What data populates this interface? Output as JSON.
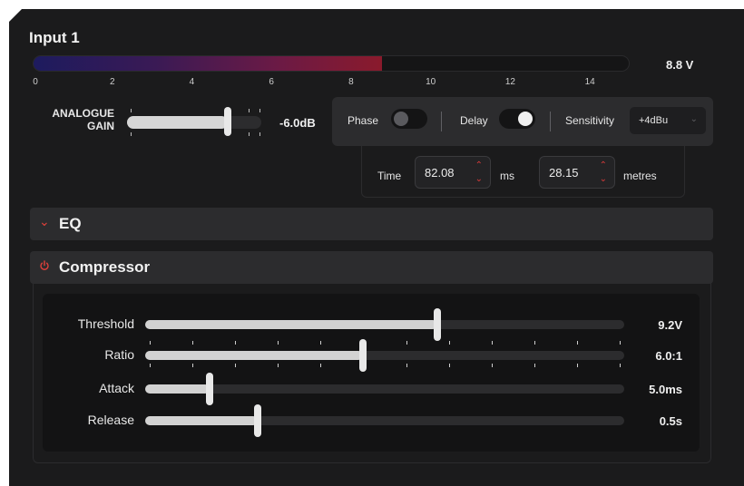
{
  "title": "Input 1",
  "meter": {
    "level_fraction": 0.585,
    "value": "8.8 V",
    "scale": [
      "0",
      "2",
      "4",
      "6",
      "8",
      "10",
      "12",
      "14"
    ]
  },
  "analogue_gain": {
    "label_line1": "ANALOGUE",
    "label_line2": "GAIN",
    "value": "-6.0dB",
    "level_fraction": 0.75
  },
  "options": {
    "phase_label": "Phase",
    "phase_on": false,
    "delay_label": "Delay",
    "delay_on": true,
    "sensitivity_label": "Sensitivity",
    "sensitivity_value": "+4dBu",
    "chevron_icon": "chevron-down-icon"
  },
  "delay_time": {
    "time_label": "Time",
    "time_value": "82.08",
    "time_unit": "ms",
    "distance_value": "28.15",
    "distance_unit": "metres"
  },
  "sections": {
    "eq_title": "EQ",
    "eq_icon": "chevron-down-icon",
    "compressor_title": "Compressor",
    "compressor_icon": "power-icon"
  },
  "compressor": {
    "threshold": {
      "label": "Threshold",
      "value": "9.2V",
      "level_fraction": 0.61
    },
    "ratio": {
      "label": "Ratio",
      "value": "6.0:1",
      "level_fraction": 0.455
    },
    "attack": {
      "label": "Attack",
      "value": "5.0ms",
      "level_fraction": 0.135
    },
    "release": {
      "label": "Release",
      "value": "0.5s",
      "level_fraction": 0.235
    }
  },
  "colors": {
    "accent_red": "#d93a3a",
    "panel_bg": "#1b1b1c"
  }
}
